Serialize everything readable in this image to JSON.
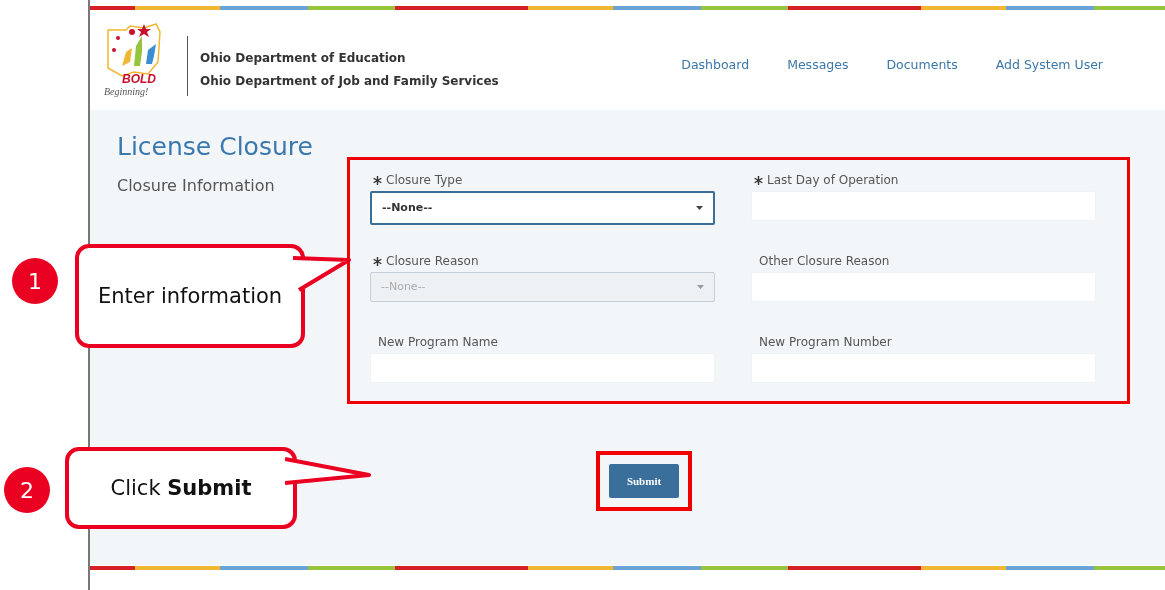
{
  "header": {
    "logo": {
      "word": "BOLD",
      "tagline": "Beginning!"
    },
    "agencies": [
      "Ohio Department of Education",
      "Ohio Department of Job and Family Services"
    ],
    "nav": [
      "Dashboard",
      "Messages",
      "Documents",
      "Add System User"
    ]
  },
  "page": {
    "title": "License Closure",
    "section": "Closure Information",
    "fields": [
      {
        "label": "Closure Type",
        "required": true,
        "kind": "select",
        "value": "--None--",
        "focused": true,
        "disabled": false
      },
      {
        "label": "Last Day of Operation",
        "required": true,
        "kind": "text",
        "focused": false,
        "disabled": false
      },
      {
        "label": "Closure Reason",
        "required": true,
        "kind": "select",
        "value": "--None--",
        "focused": false,
        "disabled": true
      },
      {
        "label": "Other Closure Reason",
        "required": false,
        "kind": "text",
        "focused": false,
        "disabled": false
      },
      {
        "label": "New Program Name",
        "required": false,
        "kind": "text",
        "focused": false,
        "disabled": false
      },
      {
        "label": "New Program Number",
        "required": false,
        "kind": "text",
        "focused": false,
        "disabled": false
      }
    ],
    "submit": "Submit"
  },
  "callouts": [
    {
      "number": "1",
      "text": "Enter information"
    },
    {
      "number": "2",
      "text": "Click **Submit**"
    }
  ]
}
